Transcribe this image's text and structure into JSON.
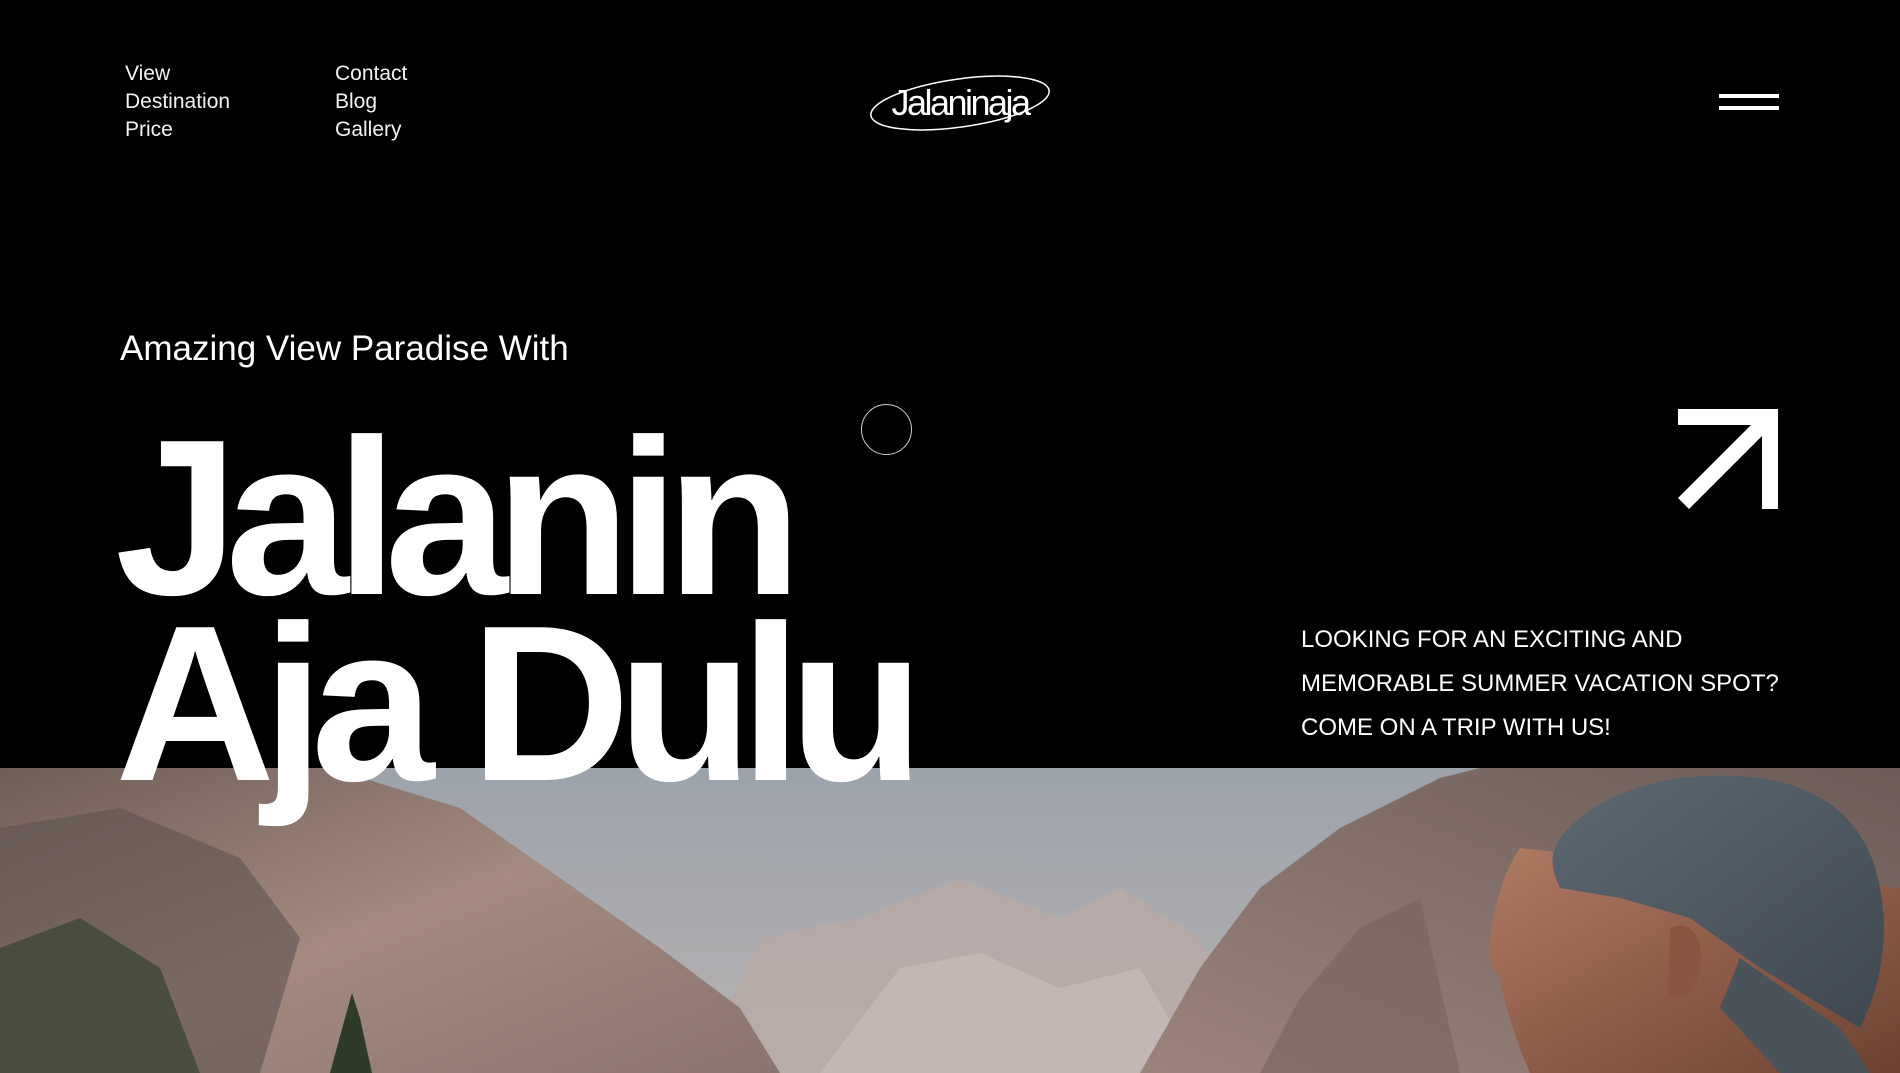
{
  "nav": {
    "left_links": [
      "View",
      "Destination",
      "Price"
    ],
    "right_links": [
      "Contact",
      "Blog",
      "Gallery"
    ]
  },
  "logo": {
    "text": "Jalaninaja"
  },
  "menu": {
    "icon": "hamburger-menu-icon"
  },
  "hero": {
    "subtitle": "Amazing View Paradise With",
    "title_line1": "Jalanin",
    "title_line2": "Aja Dulu",
    "arrow_icon": "arrow-up-right-icon",
    "tagline_lines": [
      "LOOKING FOR AN EXCITING AND",
      "MEMORABLE SUMMER VACATION SPOT?",
      "COME ON A TRIP WITH US!"
    ]
  },
  "colors": {
    "background": "#000000",
    "text": "#ffffff"
  }
}
